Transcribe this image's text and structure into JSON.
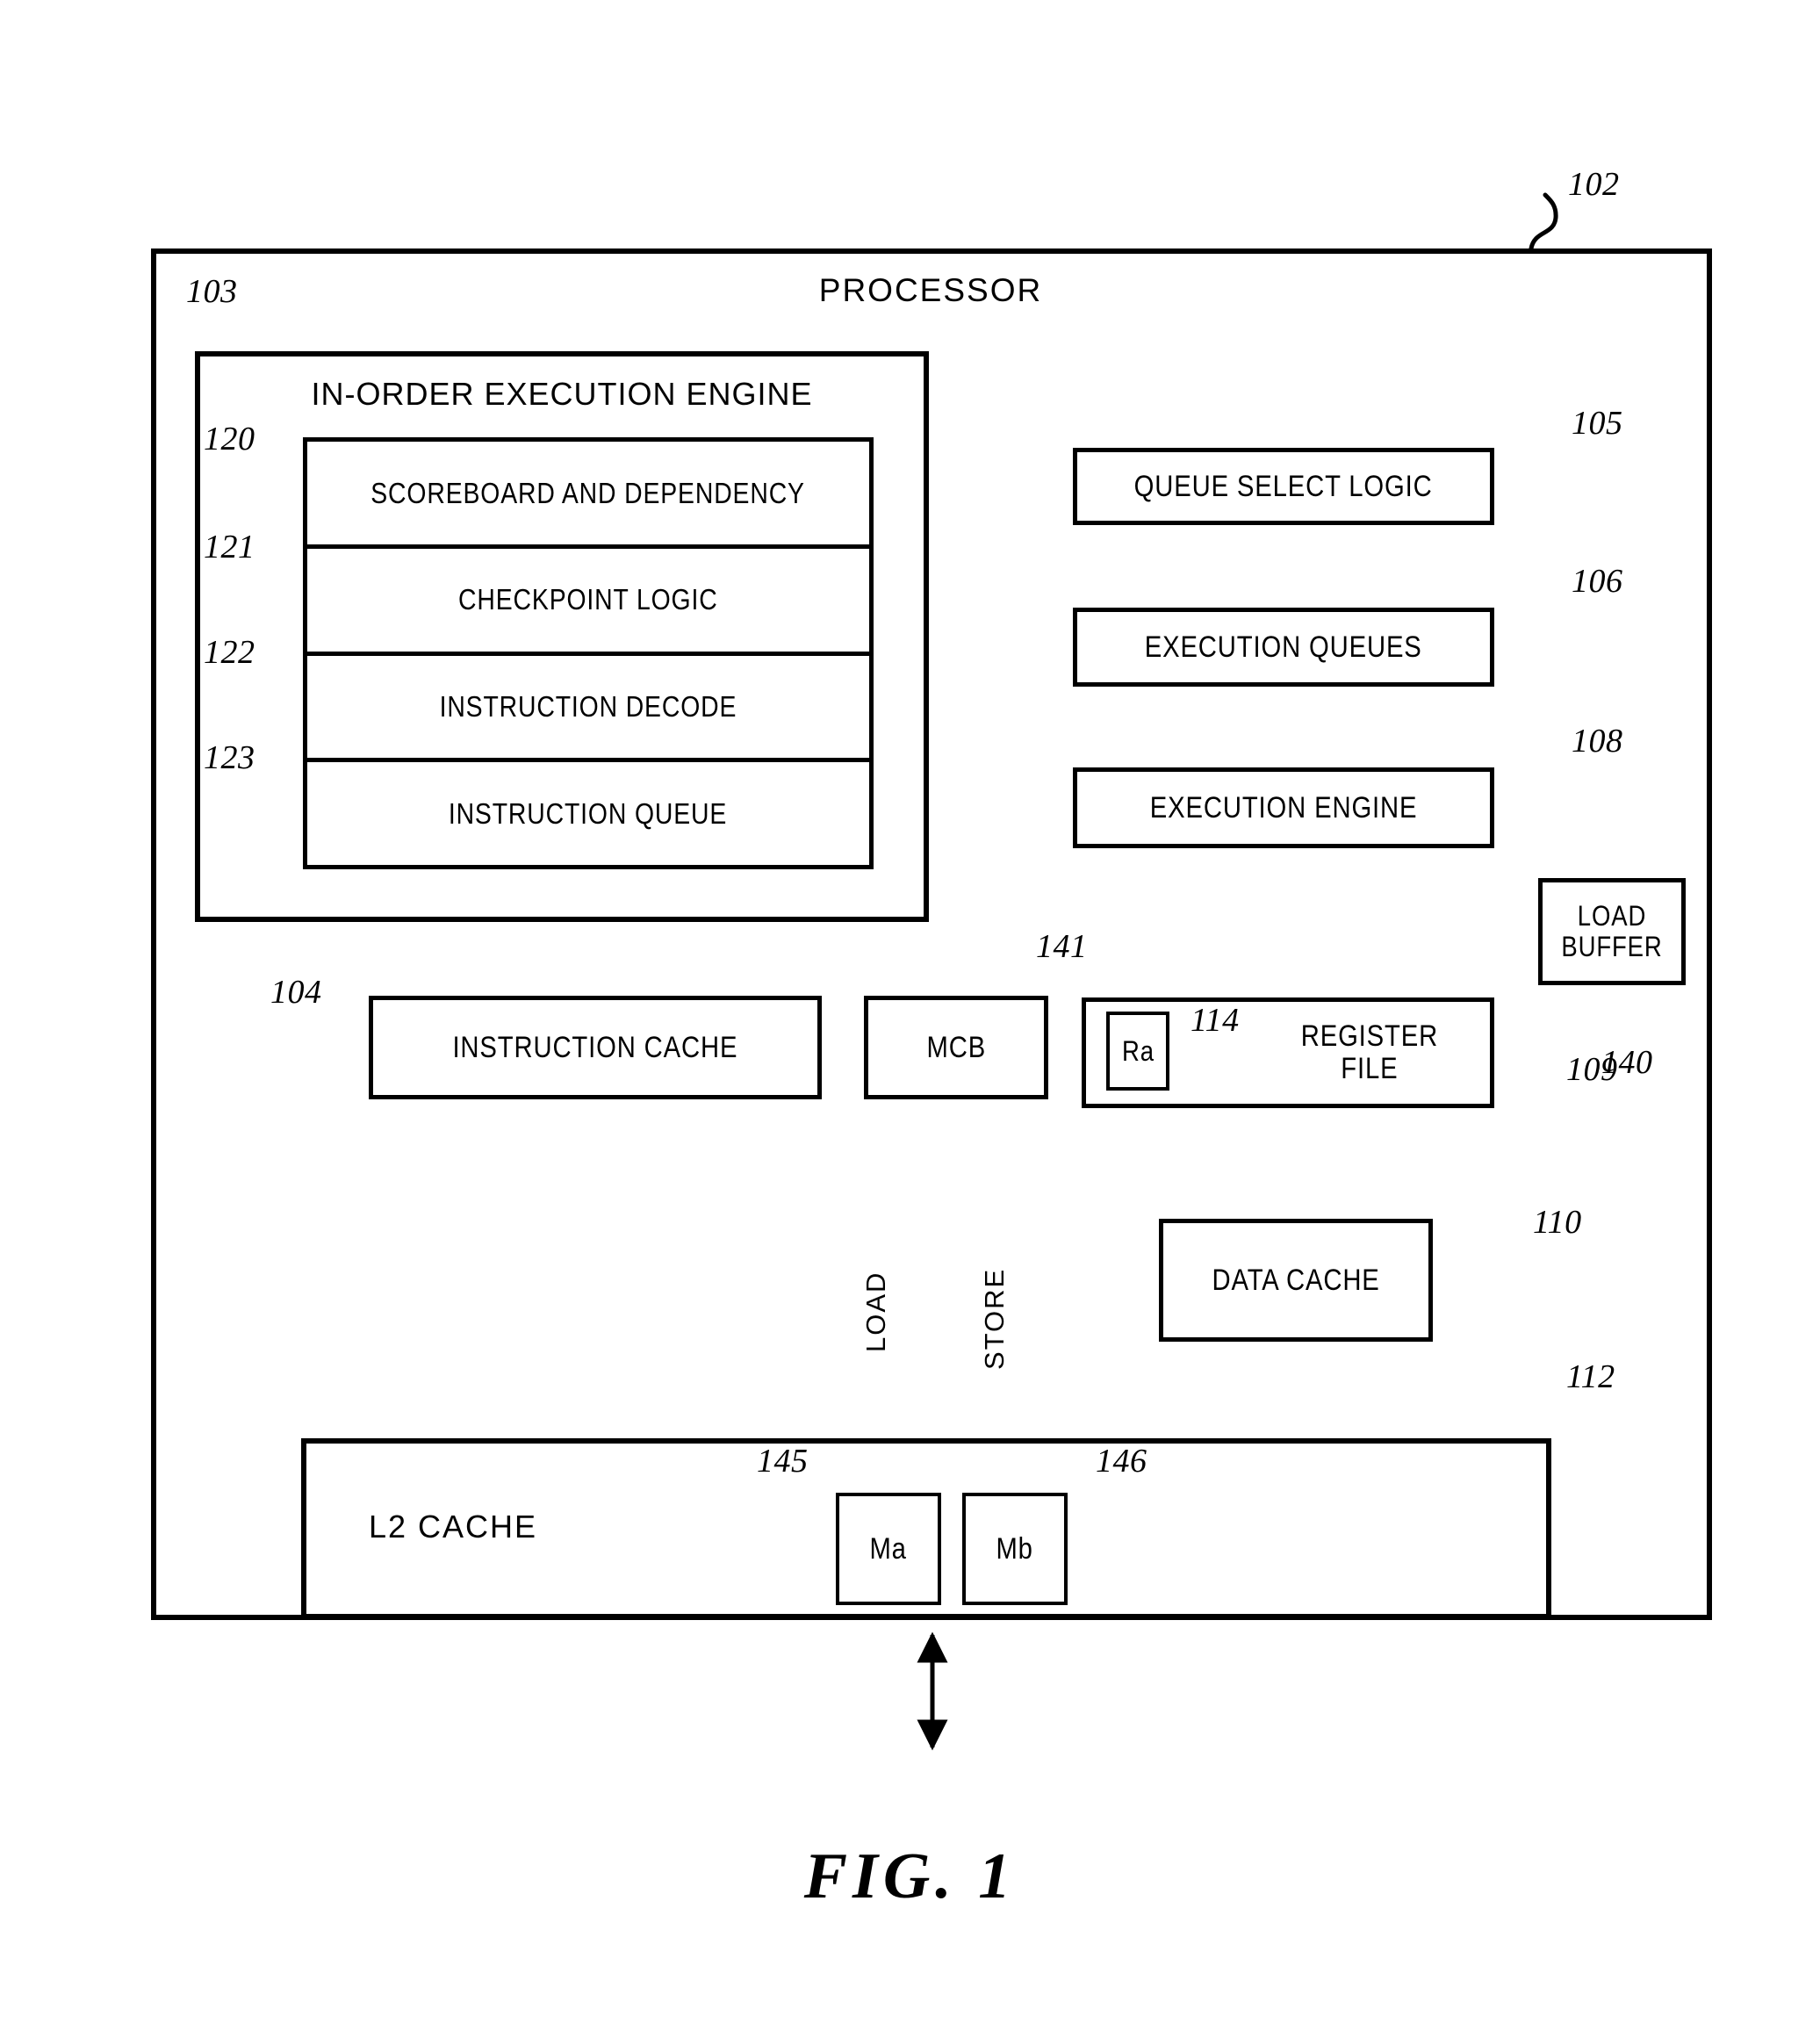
{
  "figure": {
    "caption": "FIG. 1",
    "title": "PROCESSOR"
  },
  "blocks": {
    "processor": {
      "label": "PROCESSOR",
      "ref": "102"
    },
    "in_order_execution_engine": {
      "label": "IN-ORDER EXECUTION ENGINE",
      "ref": "103"
    },
    "scoreboard": {
      "label": "SCOREBOARD AND DEPENDENCY",
      "ref": "120"
    },
    "checkpoint_logic": {
      "label": "CHECKPOINT LOGIC",
      "ref": "121"
    },
    "instruction_decode": {
      "label": "INSTRUCTION DECODE",
      "ref": "122"
    },
    "instruction_queue": {
      "label": "INSTRUCTION QUEUE",
      "ref": "123"
    },
    "queue_select_logic": {
      "label": "QUEUE SELECT LOGIC",
      "ref": "105"
    },
    "execution_queues": {
      "label": "EXECUTION QUEUES",
      "ref": "106"
    },
    "execution_engine": {
      "label": "EXECUTION ENGINE",
      "ref": "108"
    },
    "load_buffer": {
      "label": "LOAD\nBUFFER",
      "ref": "140"
    },
    "instruction_cache": {
      "label": "INSTRUCTION CACHE",
      "ref": "104"
    },
    "mcb": {
      "label": "MCB",
      "ref": "141"
    },
    "register_file": {
      "label": "REGISTER\nFILE",
      "ref": "109"
    },
    "ra_register": {
      "label": "Ra",
      "ref": "114"
    },
    "data_cache": {
      "label": "DATA CACHE",
      "ref": "110"
    },
    "l2_cache": {
      "label": "L2 CACHE",
      "ref": "112"
    },
    "ma_block": {
      "label": "Ma",
      "ref": "145"
    },
    "mb_block": {
      "label": "Mb",
      "ref": "146"
    }
  },
  "edge_labels": {
    "load": "LOAD",
    "store": "STORE"
  },
  "colors": {
    "line": "#000000",
    "background": "#ffffff"
  }
}
